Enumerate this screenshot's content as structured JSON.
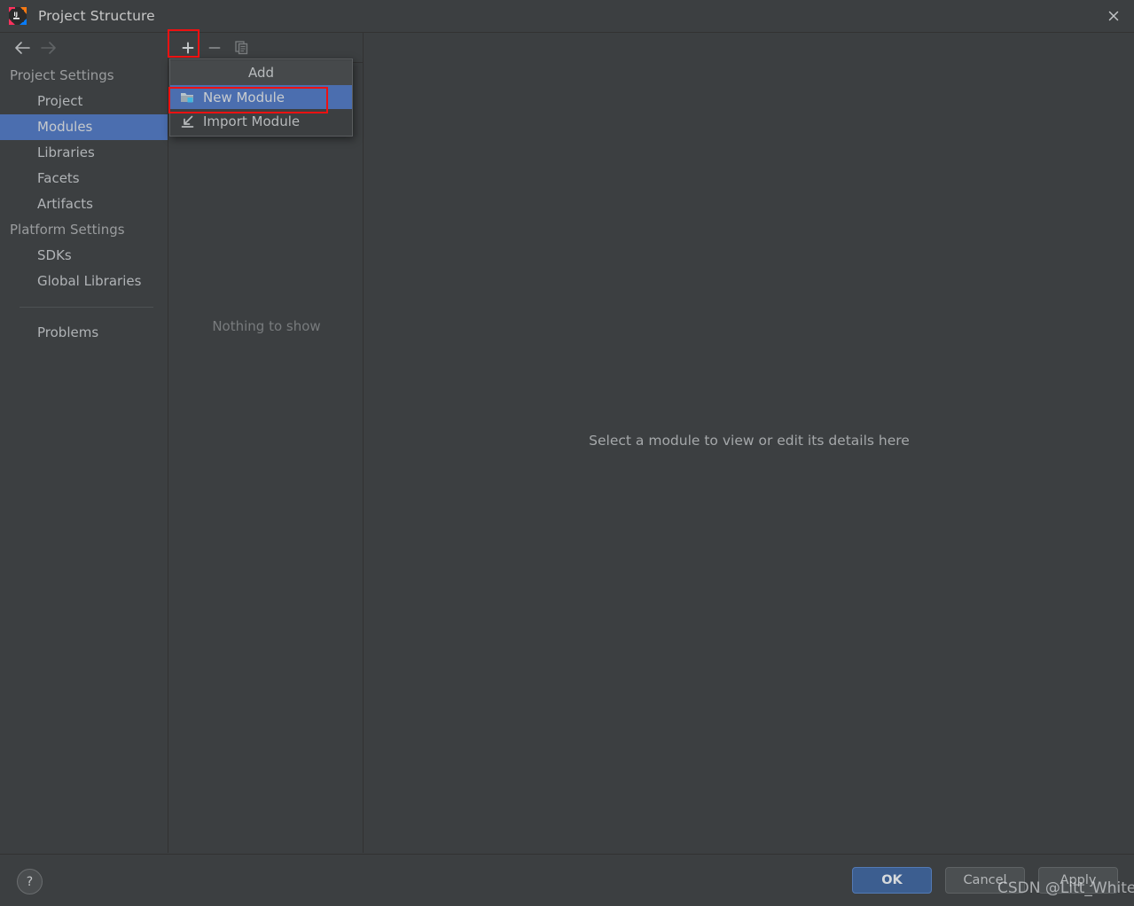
{
  "window": {
    "title": "Project Structure",
    "app_icon": "intellij-idea-icon",
    "close_icon": "close-icon"
  },
  "nav": {
    "back_icon": "arrow-left-icon",
    "forward_icon": "arrow-right-icon"
  },
  "sidebar": {
    "groups": [
      {
        "label": "Project Settings",
        "items": [
          {
            "label": "Project",
            "selected": false
          },
          {
            "label": "Modules",
            "selected": true
          },
          {
            "label": "Libraries",
            "selected": false
          },
          {
            "label": "Facets",
            "selected": false
          },
          {
            "label": "Artifacts",
            "selected": false
          }
        ]
      },
      {
        "label": "Platform Settings",
        "items": [
          {
            "label": "SDKs",
            "selected": false
          },
          {
            "label": "Global Libraries",
            "selected": false
          }
        ]
      }
    ],
    "extra_items": [
      {
        "label": "Problems"
      }
    ]
  },
  "toolbar": {
    "buttons": [
      {
        "name": "add-button",
        "icon": "plus-icon",
        "enabled": true
      },
      {
        "name": "remove-button",
        "icon": "minus-icon",
        "enabled": false
      },
      {
        "name": "copy-button",
        "icon": "copy-icon",
        "enabled": false
      }
    ]
  },
  "modules_list": {
    "empty_text": "Nothing to show"
  },
  "add_menu": {
    "header": "Add",
    "items": [
      {
        "label": "New Module",
        "icon": "new-module-folder-icon",
        "highlighted": true
      },
      {
        "label": "Import Module",
        "icon": "import-module-arrow-icon",
        "highlighted": false
      }
    ]
  },
  "details_panel": {
    "placeholder": "Select a module to view or edit its details here"
  },
  "footer": {
    "help_label": "?",
    "buttons": [
      {
        "name": "ok-button",
        "label": "OK"
      },
      {
        "name": "cancel-button",
        "label": "Cancel"
      },
      {
        "name": "apply-button",
        "label": "Apply"
      }
    ]
  },
  "watermark": {
    "text": "CSDN @Litt_White"
  },
  "colors": {
    "background": "#3c3f41",
    "selection": "#4b6eaf",
    "accent_ok": "#3c5e90",
    "annotation": "#ee1111",
    "text": "#b0b3b6",
    "text_dim": "#787b7d"
  }
}
